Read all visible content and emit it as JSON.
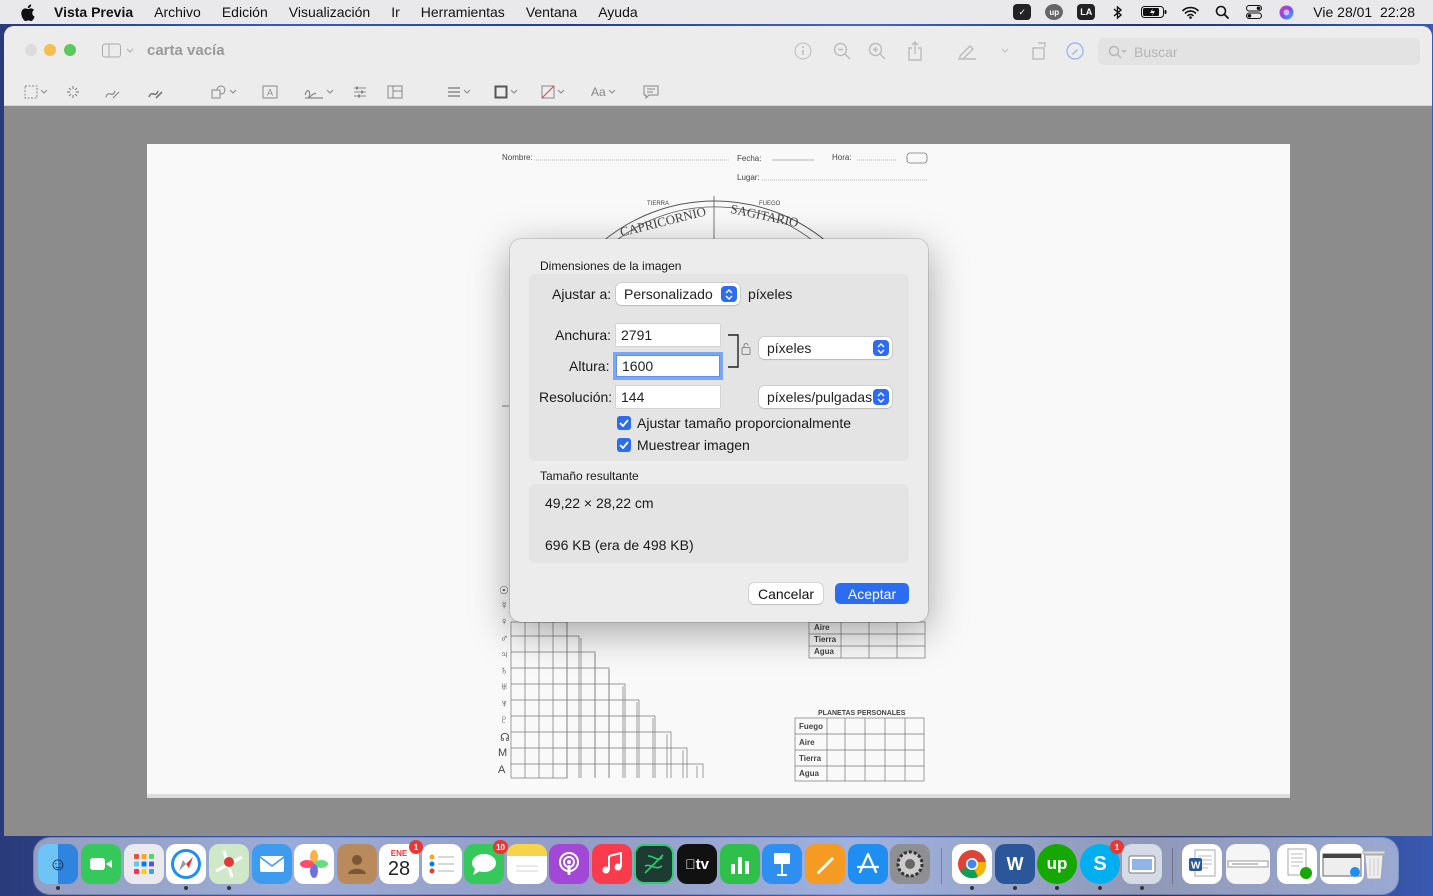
{
  "menubar": {
    "app_name": "Vista Previa",
    "items": [
      "Archivo",
      "Edición",
      "Visualización",
      "Ir",
      "Herramientas",
      "Ventana",
      "Ayuda"
    ],
    "status_icons": [
      "checkbox-icon",
      "upwork-icon",
      "input-source-icon",
      "bluetooth-icon",
      "battery-icon",
      "wifi-icon",
      "spotlight-icon",
      "control-center-icon",
      "siri-icon"
    ],
    "input_source": "LA",
    "clock": "Vie 28/01  22:28"
  },
  "window": {
    "title": "carta vacía",
    "search_placeholder": "Buscar"
  },
  "document": {
    "nombre_label": "Nombre:",
    "fecha_label": "Fecha:",
    "hora_label": "Hora:",
    "lugar_label": "Lugar:",
    "capricornio": "CAPRICORNIO",
    "sagitario": "SAGITARIO",
    "tierra_small": "TIERRA",
    "fuego_small": "FUEGO",
    "table_a_rows": [
      "Aire",
      "Tierra",
      "Agua"
    ],
    "table_b_title": "PLANETAS PERSONALES",
    "table_b_rows": [
      "Fuego",
      "Aire",
      "Tierra",
      "Agua"
    ],
    "planet_symbols": [
      "☉",
      "☿",
      "♀",
      "♂",
      "♃",
      "♄",
      "♅",
      "♆",
      "♇",
      "☊",
      "M",
      "A"
    ]
  },
  "dialog": {
    "section_title": "Dimensiones de la imagen",
    "fit_label": "Ajustar a:",
    "fit_value": "Personalizado",
    "fit_unit": "píxeles",
    "width_label": "Anchura:",
    "width_value": "2791",
    "height_label": "Altura:",
    "height_value": "1600",
    "unit_value": "píxeles",
    "resolution_label": "Resolución:",
    "resolution_value": "144",
    "resolution_unit": "píxeles/pulgadas",
    "scale_proportionally": "Ajustar tamaño proporcionalmente",
    "resample": "Muestrear imagen",
    "result_title": "Tamaño resultante",
    "result_size": "49,22 × 28,22 cm",
    "result_bytes": "696 KB (era de 498 KB)",
    "cancel": "Cancelar",
    "ok": "Aceptar"
  },
  "dock": {
    "calendar_month": "ENE",
    "calendar_day": "28",
    "calendar_badge": "1",
    "messages_badge": "10",
    "skype_badge": "1",
    "tv_label": "tv",
    "upwork_label": "up",
    "word_label": "W",
    "skype_label": "S"
  }
}
